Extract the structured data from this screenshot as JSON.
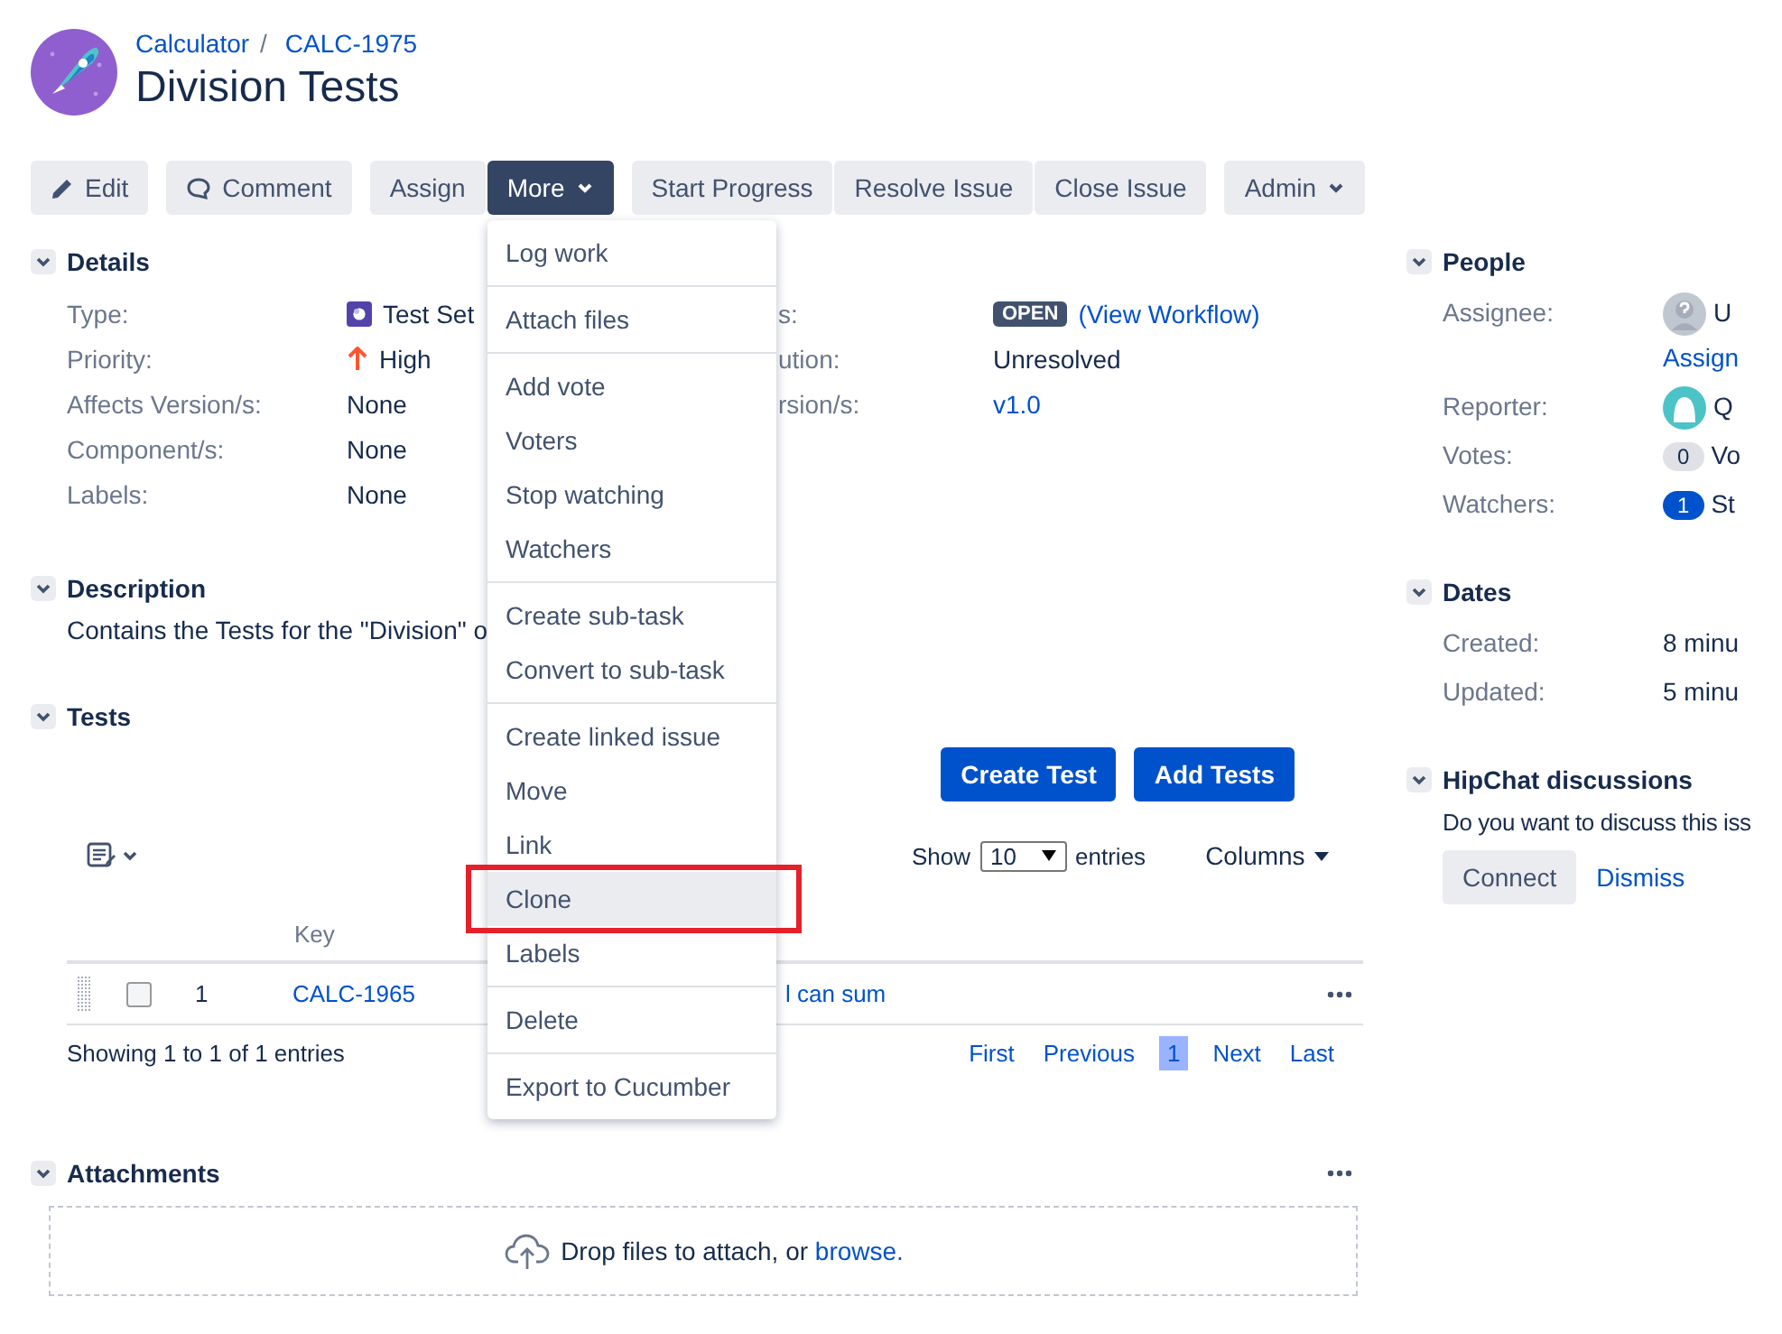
{
  "breadcrumb": {
    "project": "Calculator",
    "separator": "/",
    "issue_key": "CALC-1975"
  },
  "title": "Division Tests",
  "toolbar": [
    [
      {
        "label": "Edit",
        "kind": "edit",
        "expanded": false
      }
    ],
    [
      {
        "label": "Comment",
        "kind": "comment",
        "expanded": false
      }
    ],
    [
      {
        "label": "Assign",
        "kind": "plain",
        "expanded": false
      },
      {
        "label": "More",
        "kind": "dropdown",
        "expanded": true
      }
    ],
    [
      {
        "label": "Start Progress",
        "kind": "plain",
        "expanded": false
      },
      {
        "label": "Resolve Issue",
        "kind": "plain",
        "expanded": false
      },
      {
        "label": "Close Issue",
        "kind": "plain",
        "expanded": false
      }
    ],
    [
      {
        "label": "Admin",
        "kind": "dropdown",
        "expanded": false
      }
    ]
  ],
  "more_menu": [
    [
      {
        "label": "Log work",
        "highlighted": false
      }
    ],
    [
      {
        "label": "Attach files",
        "highlighted": false
      }
    ],
    [
      {
        "label": "Add vote",
        "highlighted": false
      },
      {
        "label": "Voters",
        "highlighted": false
      },
      {
        "label": "Stop watching",
        "highlighted": false
      },
      {
        "label": "Watchers",
        "highlighted": false
      }
    ],
    [
      {
        "label": "Create sub-task",
        "highlighted": false
      },
      {
        "label": "Convert to sub-task",
        "highlighted": false
      }
    ],
    [
      {
        "label": "Create linked issue",
        "highlighted": false
      },
      {
        "label": "Move",
        "highlighted": false
      },
      {
        "label": "Link",
        "highlighted": false
      },
      {
        "label": "Clone",
        "highlighted": true
      },
      {
        "label": "Labels",
        "highlighted": false
      }
    ],
    [
      {
        "label": "Delete",
        "highlighted": false
      }
    ],
    [
      {
        "label": "Export to Cucumber",
        "highlighted": false
      }
    ]
  ],
  "details": {
    "title": "Details",
    "expanded": true,
    "fields": [
      {
        "label": "Type:",
        "value": "Test Set",
        "kind": "type"
      },
      {
        "label": "Priority:",
        "value": "High",
        "kind": "priority"
      },
      {
        "label": "Affects Version/s:",
        "value": "None",
        "kind": "text"
      },
      {
        "label": "Component/s:",
        "value": "None",
        "kind": "text"
      },
      {
        "label": "Labels:",
        "value": "None",
        "kind": "text"
      }
    ],
    "fields_right": [
      {
        "label": "s:",
        "value": "OPEN",
        "link": "(View Workflow)",
        "kind": "status"
      },
      {
        "label": "ution:",
        "value": "Unresolved",
        "kind": "text"
      },
      {
        "label": "rsion/s:",
        "value": "v1.0",
        "kind": "link"
      }
    ]
  },
  "description": {
    "title": "Description",
    "expanded": true,
    "text": "Contains the Tests for the \"Division\" o"
  },
  "tests": {
    "title": "Tests",
    "expanded": true,
    "buttons": [
      "Create Test",
      "Add Tests"
    ],
    "show_label": "Show",
    "page_size": "10",
    "entries_label": "entries",
    "columns_button": "Columns",
    "columns": [
      "Key"
    ],
    "rows": [
      {
        "rank": "1",
        "key": "CALC-1965",
        "summary": "l can sum",
        "checked": false
      }
    ],
    "footer": "Showing 1 to 1 of 1 entries",
    "pagination": [
      {
        "label": "First",
        "selected": false
      },
      {
        "label": "Previous",
        "selected": false
      },
      {
        "label": "1",
        "selected": true
      },
      {
        "label": "Next",
        "selected": false
      },
      {
        "label": "Last",
        "selected": false
      }
    ]
  },
  "attachments": {
    "title": "Attachments",
    "expanded": true,
    "drop_text": "Drop files to attach, or ",
    "drop_link": "browse."
  },
  "people": {
    "title": "People",
    "expanded": true,
    "fields": [
      {
        "label": "Assignee:",
        "value": "U",
        "kind": "unknown_user",
        "link": "Assign"
      },
      {
        "label": "Reporter:",
        "value": "Q",
        "kind": "user"
      },
      {
        "label": "Votes:",
        "value": "Vo",
        "kind": "count",
        "count": "0",
        "selected": false
      },
      {
        "label": "Watchers:",
        "value": "St",
        "kind": "count",
        "count": "1",
        "selected": true
      }
    ]
  },
  "dates": {
    "title": "Dates",
    "expanded": true,
    "fields": [
      {
        "label": "Created:",
        "value": "8 minu"
      },
      {
        "label": "Updated:",
        "value": "5 minu"
      }
    ]
  },
  "hipchat": {
    "title": "HipChat discussions",
    "expanded": true,
    "text": "Do you want to discuss this iss",
    "buttons": [
      "Connect",
      "Dismiss"
    ]
  }
}
